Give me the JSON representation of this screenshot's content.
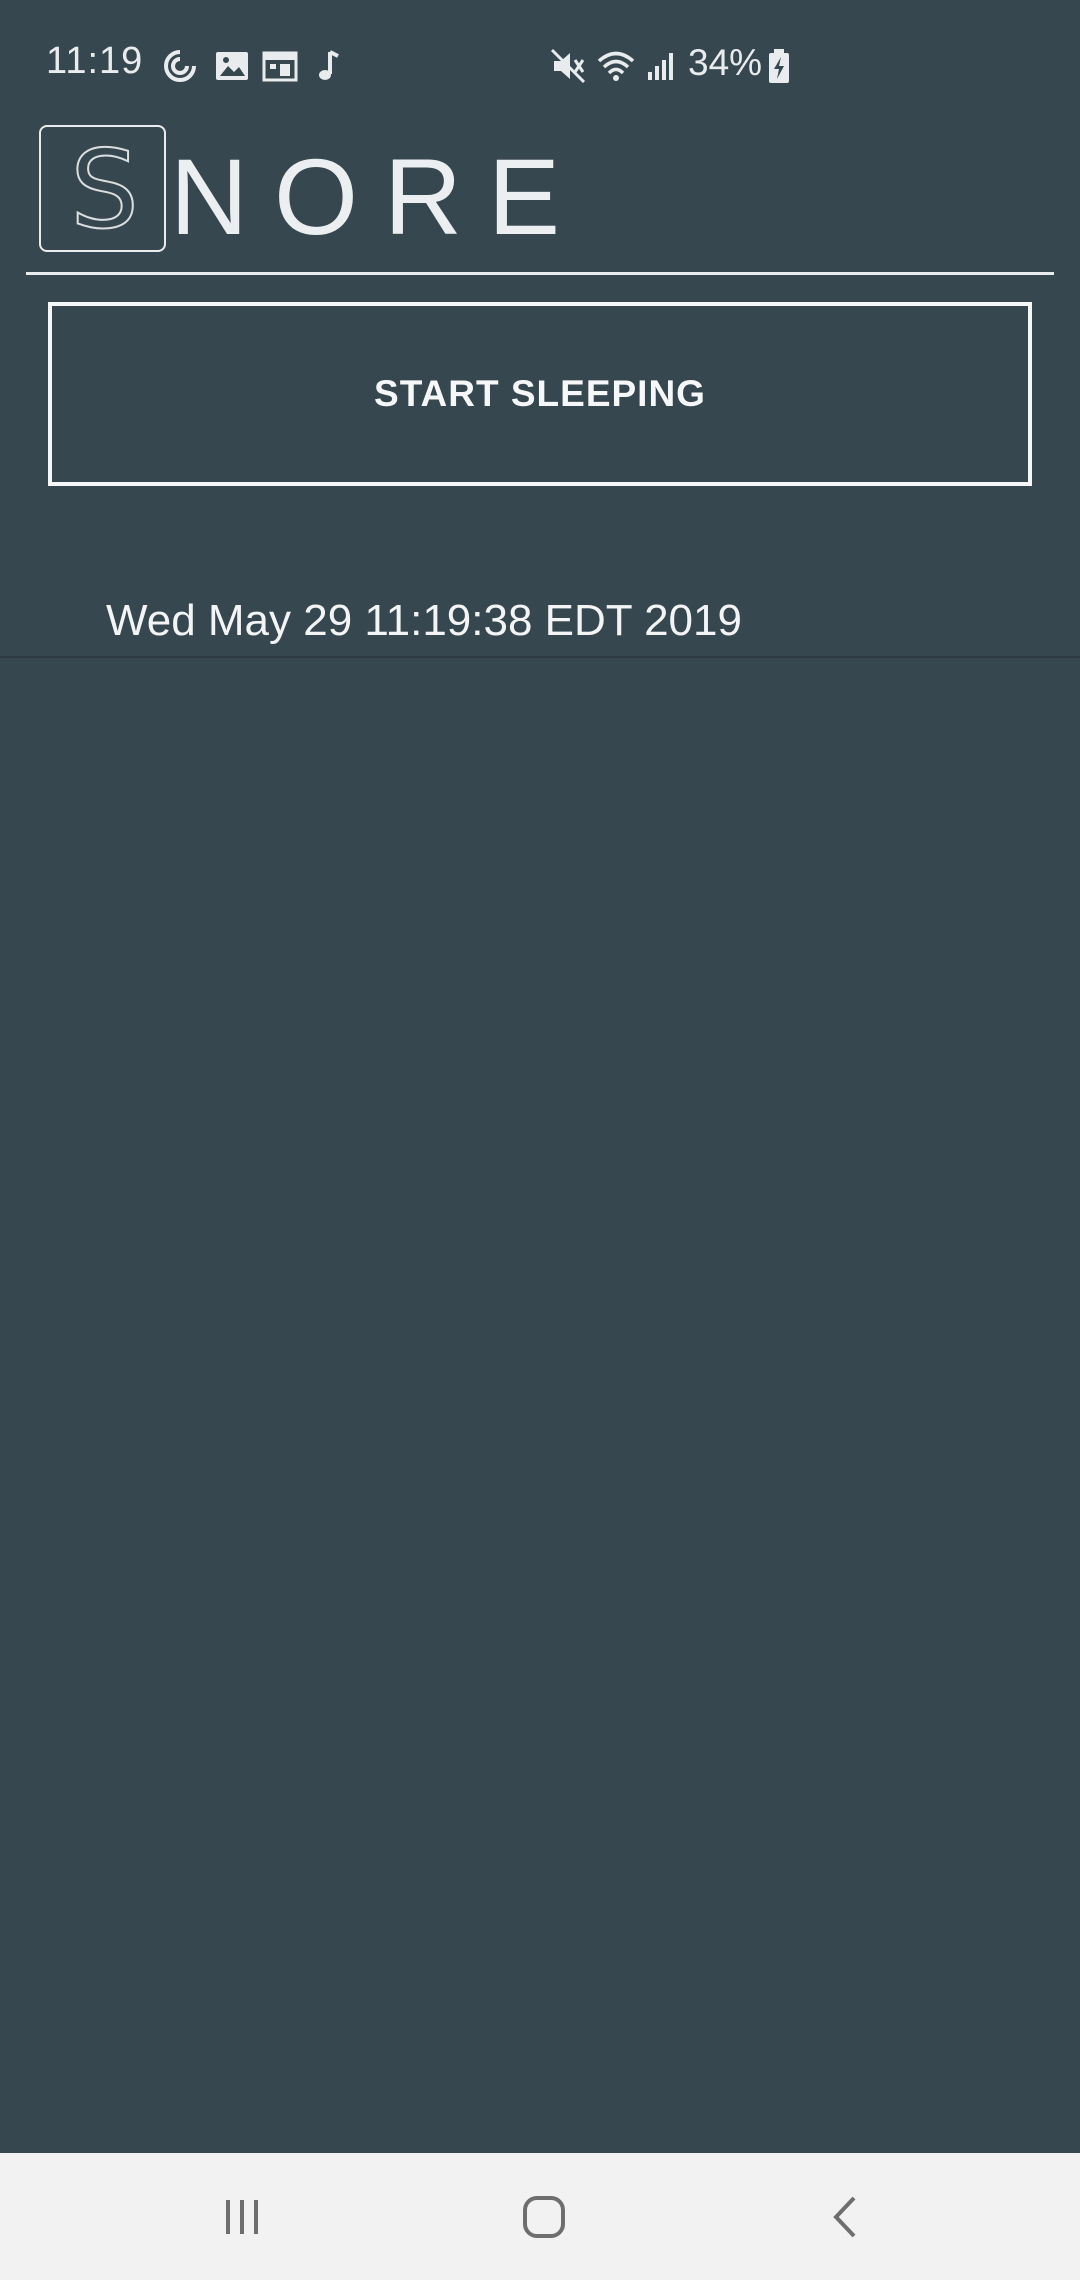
{
  "status_bar": {
    "time": "11:19",
    "battery": "34%",
    "left_icons": [
      "sync-icon",
      "image-icon",
      "calendar-icon",
      "music-note-icon"
    ],
    "right_icons": [
      "mute-icon",
      "wifi-icon",
      "signal-icon",
      "battery-charging-icon"
    ]
  },
  "header": {
    "logo_letter": "S",
    "title": "NORE"
  },
  "actions": {
    "start_label": "START SLEEPING"
  },
  "sessions": [
    {
      "label": "Wed May 29 11:19:38 EDT 2019"
    }
  ],
  "nav": {
    "buttons": [
      "recent-apps-icon",
      "home-icon",
      "back-icon"
    ]
  },
  "colors": {
    "background": "#37474f",
    "foreground": "#eceff1",
    "nav_background": "#f2f2f2"
  }
}
